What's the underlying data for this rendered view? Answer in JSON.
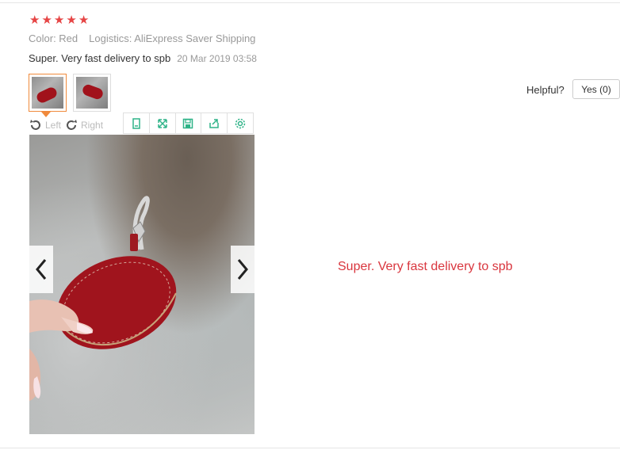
{
  "review": {
    "rating": 5,
    "stars": [
      "★",
      "★",
      "★",
      "★",
      "★"
    ],
    "color": "Color: Red",
    "logistics": "Logistics: AliExpress Saver Shipping",
    "text": "Super. Very fast delivery to spb",
    "date": "20 Mar 2019 03:58"
  },
  "helpful": {
    "label": "Helpful?",
    "yes_button": "Yes (0)"
  },
  "rotate": {
    "left_label": "Left",
    "right_label": "Right"
  },
  "toolbar": {
    "icons": [
      "page-icon",
      "expand-icon",
      "save-icon",
      "share-icon",
      "gear-icon"
    ]
  },
  "viewer": {
    "caption": "Super. Very fast delivery to spb"
  },
  "colors": {
    "star": "#e64545",
    "accent_green": "#2fb388",
    "caption_red": "#d9363e",
    "thumb_active_border": "#f08a3c"
  }
}
